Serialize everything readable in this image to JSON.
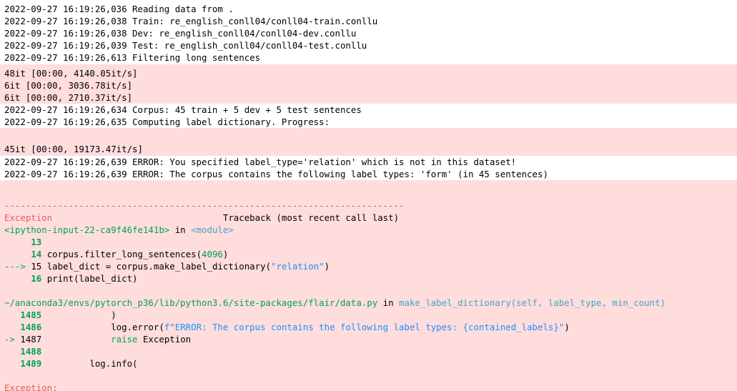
{
  "log1": [
    "2022-09-27 16:19:26,036 Reading data from .",
    "2022-09-27 16:19:26,038 Train: re_english_conll04/conll04-train.conllu",
    "2022-09-27 16:19:26,038 Dev: re_english_conll04/conll04-dev.conllu",
    "2022-09-27 16:19:26,039 Test: re_english_conll04/conll04-test.conllu",
    "2022-09-27 16:19:26,613 Filtering long sentences"
  ],
  "progress1": [
    "48it [00:00, 4140.05it/s]",
    "6it [00:00, 3036.78it/s]",
    "6it [00:00, 2710.37it/s]"
  ],
  "log2": [
    "2022-09-27 16:19:26,634 Corpus: 45 train + 5 dev + 5 test sentences",
    "2022-09-27 16:19:26,635 Computing label dictionary. Progress:"
  ],
  "progress2": [
    "",
    "45it [00:00, 19173.47it/s]"
  ],
  "log3": [
    "2022-09-27 16:19:26,639 ERROR: You specified label_type='relation' which is not in this dataset!",
    "2022-09-27 16:19:26,639 ERROR: The corpus contains the following label types: 'form' (in 45 sentences)"
  ],
  "traceback": {
    "separator": "---------------------------------------------------------------------------",
    "exception_name": "Exception",
    "header_right": "Traceback (most recent call last)",
    "frame1": {
      "file": "<ipython-input-22-ca9f46fe141b>",
      "in_word": " in ",
      "func": "<module>",
      "lines": [
        {
          "prefix": "     ",
          "no": "13",
          "code_pre": "",
          "code_colored": "",
          "code_post": ""
        },
        {
          "prefix": "     ",
          "no": "14",
          "code_pre": " corpus.filter_long_sentences(",
          "code_colored": "4096",
          "code_post": ")"
        },
        {
          "prefix": "---> ",
          "no": "15",
          "code_pre": " label_dict = corpus.make_label_dictionary(",
          "code_colored": "\"relation\"",
          "code_post": ")"
        },
        {
          "prefix": "     ",
          "no": "16",
          "code_pre": " print(label_dict)",
          "code_colored": "",
          "code_post": ""
        }
      ]
    },
    "frame2": {
      "file": "~/anaconda3/envs/pytorch_p36/lib/python3.6/site-packages/flair/data.py",
      "in_word": " in ",
      "func": "make_label_dictionary(self, label_type, min_count)",
      "lines": [
        {
          "prefix": "   ",
          "no": "1485",
          "code": "             )"
        },
        {
          "prefix": "   ",
          "no": "1486",
          "code_pre": "             log.error(",
          "code_colored": "f\"ERROR: The corpus contains the following label types: {contained_labels}\"",
          "code_post": ")"
        },
        {
          "prefix": "-> ",
          "no": "1487",
          "kw": "             raise",
          "code_post": " Exception"
        },
        {
          "prefix": "   ",
          "no": "1488",
          "code": ""
        },
        {
          "prefix": "   ",
          "no": "1489",
          "code": "         log.info("
        }
      ]
    },
    "final_exception": "Exception:"
  }
}
